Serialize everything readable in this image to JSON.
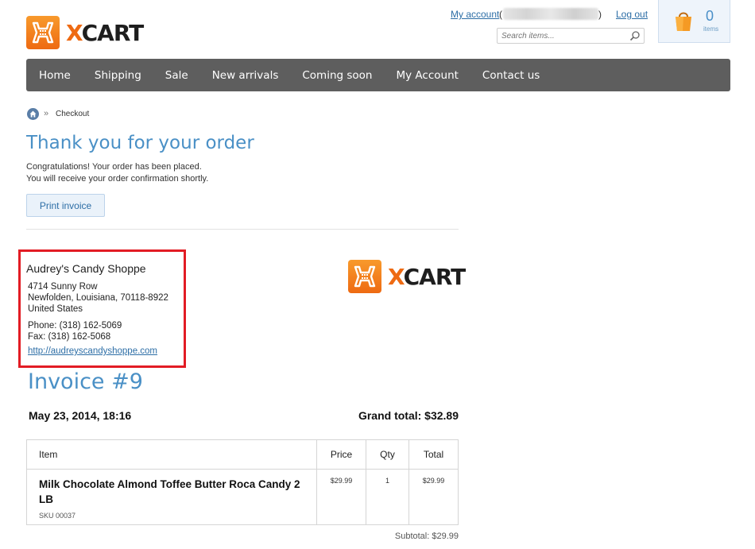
{
  "header": {
    "logo_text": "XCART",
    "my_account": "My account",
    "paren_open": "(",
    "paren_close": ")",
    "logout": "Log out",
    "search_placeholder": "Search items...",
    "cart_count": "0",
    "cart_label": "items"
  },
  "nav": {
    "items": [
      "Home",
      "Shipping",
      "Sale",
      "New arrivals",
      "Coming soon",
      "My Account",
      "Contact us"
    ]
  },
  "breadcrumb": {
    "separator": "»",
    "current": "Checkout"
  },
  "thanks": {
    "title": "Thank you for your order",
    "line1": "Congratulations! Your order has been placed.",
    "line2": "You will receive your order confirmation shortly.",
    "print_button": "Print invoice"
  },
  "company": {
    "name": "Audrey's Candy Shoppe",
    "address1": "4714 Sunny Row",
    "address2": "Newfolden, Louisiana, 70118-8922",
    "country": "United States",
    "phone": "Phone: (318) 162-5069",
    "fax": "Fax: (318) 162-5068",
    "url": "http://audreyscandyshoppe.com"
  },
  "invoice": {
    "title": "Invoice #9",
    "date": "May 23, 2014, 18:16",
    "grand_total": "Grand total: $32.89",
    "columns": [
      "Item",
      "Price",
      "Qty",
      "Total"
    ],
    "rows": [
      {
        "name": "Milk Chocolate Almond Toffee Butter Roca Candy 2 LB",
        "sku": "SKU 00037",
        "price": "$29.99",
        "qty": "1",
        "total": "$29.99"
      }
    ],
    "subtotal": "Subtotal: $29.99"
  },
  "colors": {
    "accent": "#4a90c6",
    "brand_orange": "#ee6a12",
    "nav_bg": "#5e5e5e",
    "highlight": "#e21c24"
  },
  "icons": {
    "cart": "shopping-bag-icon",
    "search": "magnifier-icon",
    "home": "home-icon"
  }
}
